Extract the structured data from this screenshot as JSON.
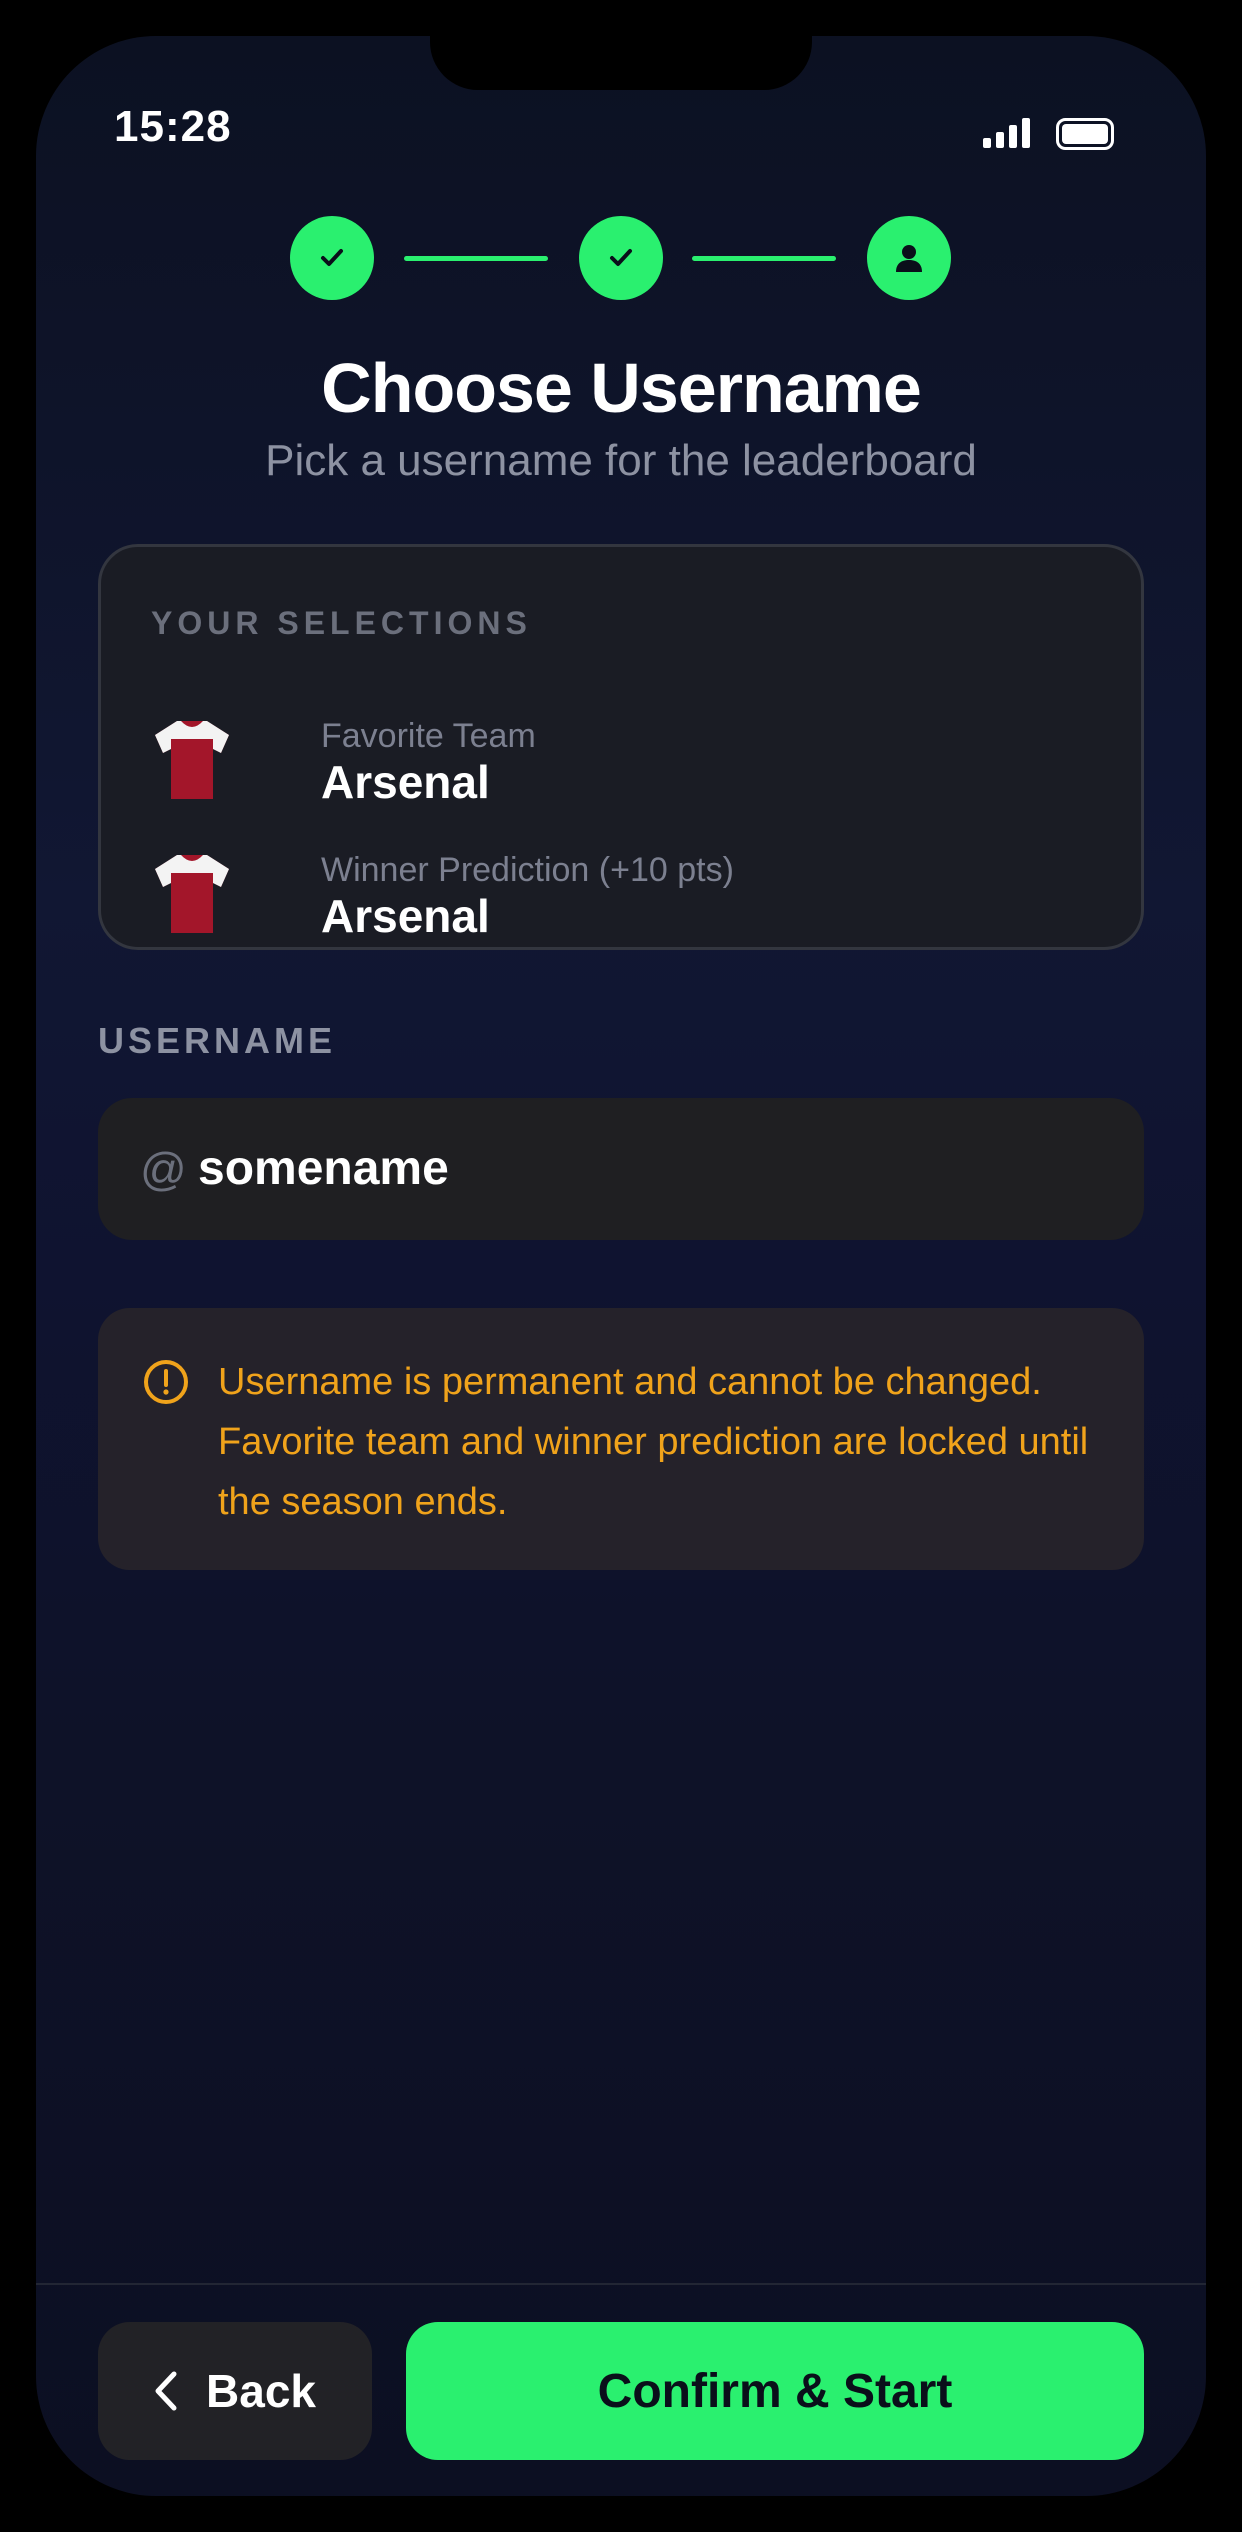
{
  "status_bar": {
    "time": "15:28",
    "signal_icon": "cellular-signal-icon",
    "battery_icon": "battery-icon"
  },
  "stepper": {
    "steps": [
      {
        "state": "completed",
        "icon": "checkmark-icon"
      },
      {
        "state": "completed",
        "icon": "checkmark-icon"
      },
      {
        "state": "current",
        "icon": "user-icon"
      }
    ],
    "accent": "#2af06f"
  },
  "header": {
    "title": "Choose Username",
    "subtitle": "Pick a username for the leaderboard"
  },
  "selections": {
    "heading": "YOUR SELECTIONS",
    "items": [
      {
        "label": "Favorite Team",
        "value": "Arsenal",
        "icon": "jersey-icon"
      },
      {
        "label": "Winner Prediction (+10 pts)",
        "value": "Arsenal",
        "icon": "jersey-icon"
      }
    ]
  },
  "username": {
    "label": "USERNAME",
    "prefix": "@",
    "value": "somename"
  },
  "warning": {
    "icon": "alert-circle-icon",
    "text": "Username is permanent and cannot be changed. Favorite team and winner prediction are locked until the season ends.",
    "color": "#f0a31b"
  },
  "footer": {
    "back_label": "Back",
    "confirm_label": "Confirm & Start"
  }
}
